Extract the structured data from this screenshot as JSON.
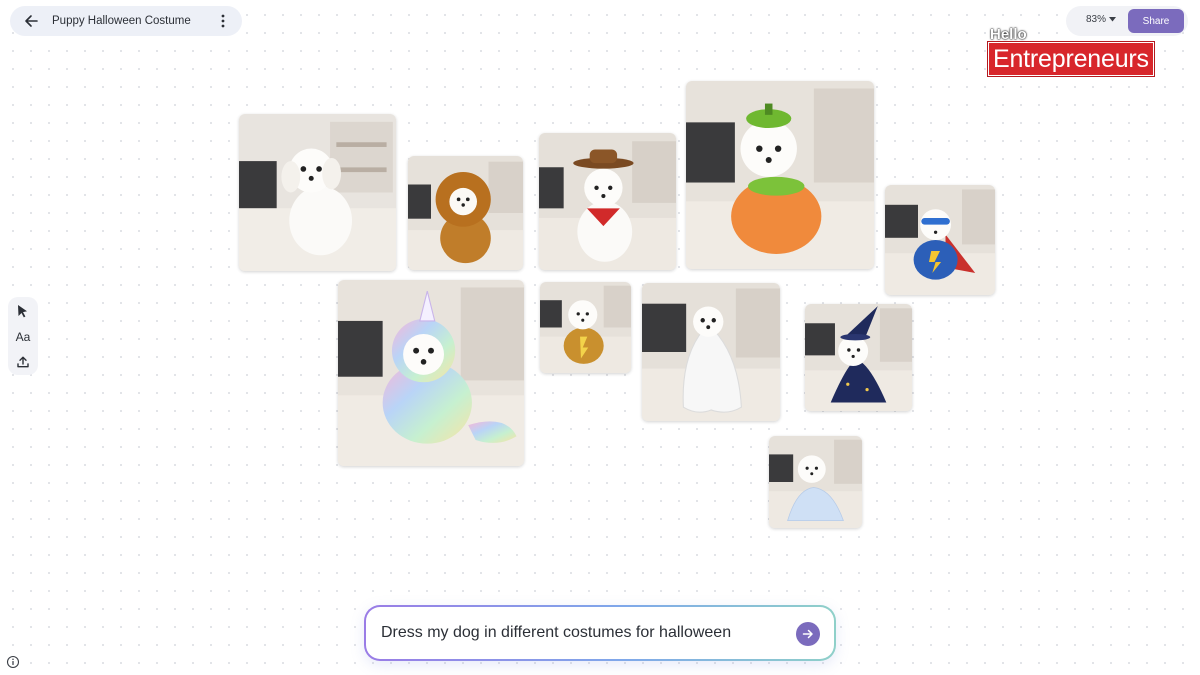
{
  "header": {
    "back_icon": "arrow-left-icon",
    "title": "Puppy Halloween Costume",
    "more_icon": "more-vertical-icon"
  },
  "controls": {
    "zoom_label": "83%",
    "zoom_icon": "caret-down-icon",
    "share_label": "Share",
    "accent_color": "#7b6bbd"
  },
  "logo": {
    "hello": "Hello",
    "brand": "Entrepreneurs",
    "brand_color": "#d8262b"
  },
  "toolbar": {
    "tools": [
      {
        "icon": "cursor-arrow-icon"
      },
      {
        "icon": "text-icon",
        "label": "Aa"
      },
      {
        "icon": "upload-icon"
      }
    ]
  },
  "images": [
    {
      "costume": "none",
      "name": "puppy-plain-image"
    },
    {
      "costume": "lion",
      "name": "puppy-lion-image"
    },
    {
      "costume": "cowboy",
      "name": "puppy-cowboy-image"
    },
    {
      "costume": "pumpkin",
      "name": "puppy-pumpkin-image"
    },
    {
      "costume": "superhero",
      "name": "puppy-superhero-image"
    },
    {
      "costume": "unicorn",
      "name": "puppy-unicorn-image"
    },
    {
      "costume": "yellow-jacket",
      "name": "puppy-jacket-image"
    },
    {
      "costume": "ghost",
      "name": "puppy-ghost-image"
    },
    {
      "costume": "wizard",
      "name": "puppy-wizard-image"
    },
    {
      "costume": "princess",
      "name": "puppy-princess-image"
    }
  ],
  "prompt": {
    "text": "Dress my dog in different costumes for halloween",
    "send_icon": "arrow-right-circle-icon"
  },
  "footer": {
    "info_icon": "info-icon"
  }
}
